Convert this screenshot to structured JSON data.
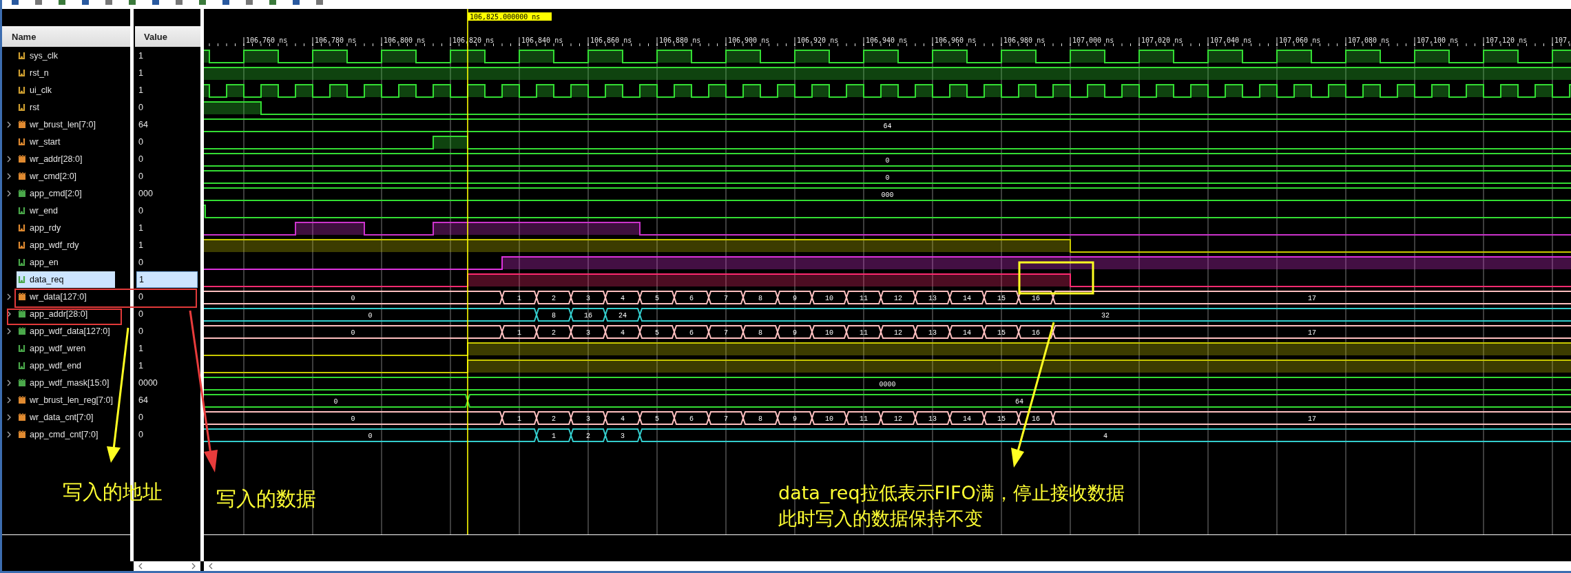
{
  "header": {
    "name": "Name",
    "value": "Value"
  },
  "ruler": {
    "cursor_label": "106,825.000000 ns",
    "ticks": [
      "106,760 ns",
      "106,780 ns",
      "106,800 ns",
      "106,820 ns",
      "106,840 ns",
      "106,860 ns",
      "106,880 ns",
      "106,900 ns",
      "106,920 ns",
      "106,940 ns",
      "106,960 ns",
      "106,980 ns",
      "107,000 ns",
      "107,020 ns",
      "107,040 ns",
      "107,060 ns",
      "107,080 ns",
      "107,100 ns",
      "107,120 ns",
      "107,"
    ]
  },
  "rows": [
    {
      "name": "sys_clk",
      "value": "1",
      "kind": "bit",
      "color": "#33dd33",
      "icon": {
        "color": "#d0a030"
      },
      "selected": false
    },
    {
      "name": "rst_n",
      "value": "1",
      "kind": "bit",
      "color": "#33dd33",
      "icon": {
        "color": "#d0a030"
      },
      "selected": false
    },
    {
      "name": "ui_clk",
      "value": "1",
      "kind": "bit",
      "color": "#33dd33",
      "icon": {
        "color": "#d0a030"
      },
      "selected": false
    },
    {
      "name": "rst",
      "value": "0",
      "kind": "bit",
      "color": "#33dd33",
      "icon": {
        "color": "#d0a030"
      },
      "selected": false
    },
    {
      "name": "wr_brust_len[7:0]",
      "value": "64",
      "kind": "bus",
      "color": "#33dd33",
      "icon": {
        "color": "#e08a30"
      },
      "selected": false,
      "expanded": false,
      "segments": [
        "64"
      ]
    },
    {
      "name": "wr_start",
      "value": "0",
      "kind": "bit",
      "color": "#33dd33",
      "icon": {
        "color": "#e08a30"
      },
      "selected": false
    },
    {
      "name": "wr_addr[28:0]",
      "value": "0",
      "kind": "bus",
      "color": "#33dd33",
      "icon": {
        "color": "#e08a30"
      },
      "selected": false,
      "expanded": false,
      "segments": [
        "0"
      ]
    },
    {
      "name": "wr_cmd[2:0]",
      "value": "0",
      "kind": "bus",
      "color": "#33dd33",
      "icon": {
        "color": "#e08a30"
      },
      "selected": false,
      "expanded": false,
      "segments": [
        "0"
      ]
    },
    {
      "name": "app_cmd[2:0]",
      "value": "000",
      "kind": "bus",
      "color": "#33dd33",
      "icon": {
        "color": "#4aa84a"
      },
      "selected": false,
      "expanded": false,
      "segments": [
        "000"
      ]
    },
    {
      "name": "wr_end",
      "value": "0",
      "kind": "bit",
      "color": "#33dd33",
      "icon": {
        "color": "#4aa84a"
      },
      "selected": false
    },
    {
      "name": "app_rdy",
      "value": "1",
      "kind": "bit",
      "color": "#cc33cc",
      "icon": {
        "color": "#e08a30"
      },
      "selected": false
    },
    {
      "name": "app_wdf_rdy",
      "value": "1",
      "kind": "bit",
      "color": "#c8c800",
      "icon": {
        "color": "#e08a30"
      },
      "selected": false
    },
    {
      "name": "app_en",
      "value": "0",
      "kind": "bit",
      "color": "#dd33dd",
      "icon": {
        "color": "#4aa84a"
      },
      "selected": false
    },
    {
      "name": "data_req",
      "value": "1",
      "kind": "bit",
      "color": "#ff2a70",
      "icon": {
        "color": "#4aa84a"
      },
      "selected": true
    },
    {
      "name": "wr_data[127:0]",
      "value": "0",
      "kind": "bus",
      "color": "#ffc0c0",
      "icon": {
        "color": "#e08a30"
      },
      "selected": false,
      "expanded": false,
      "segments": [
        "0",
        "1",
        "2",
        "3",
        "4",
        "5",
        "6",
        "7",
        "8",
        "9",
        "10",
        "11",
        "12",
        "13",
        "14",
        "15",
        "16",
        "17"
      ]
    },
    {
      "name": "app_addr[28:0]",
      "value": "0",
      "kind": "bus",
      "color": "#33cccc",
      "icon": {
        "color": "#4aa84a"
      },
      "selected": false,
      "expanded": false,
      "segments": [
        "0",
        "8",
        "16",
        "24",
        "32"
      ]
    },
    {
      "name": "app_wdf_data[127:0]",
      "value": "0",
      "kind": "bus",
      "color": "#ffc0c0",
      "icon": {
        "color": "#4aa84a"
      },
      "selected": false,
      "expanded": false,
      "segments": [
        "0",
        "1",
        "2",
        "3",
        "4",
        "5",
        "6",
        "7",
        "8",
        "9",
        "10",
        "11",
        "12",
        "13",
        "14",
        "15",
        "16",
        "17"
      ]
    },
    {
      "name": "app_wdf_wren",
      "value": "1",
      "kind": "bit",
      "color": "#c8c800",
      "icon": {
        "color": "#4aa84a"
      },
      "selected": false
    },
    {
      "name": "app_wdf_end",
      "value": "1",
      "kind": "bit",
      "color": "#c8c800",
      "icon": {
        "color": "#4aa84a"
      },
      "selected": false
    },
    {
      "name": "app_wdf_mask[15:0]",
      "value": "0000",
      "kind": "bus",
      "color": "#33dd33",
      "icon": {
        "color": "#4aa84a"
      },
      "selected": false,
      "expanded": false,
      "segments": [
        "0000"
      ]
    },
    {
      "name": "wr_brust_len_reg[7:0]",
      "value": "64",
      "kind": "bus",
      "color": "#33dd33",
      "icon": {
        "color": "#e08a30"
      },
      "selected": false,
      "expanded": false,
      "segments": [
        "0",
        "64"
      ]
    },
    {
      "name": "wr_data_cnt[7:0]",
      "value": "0",
      "kind": "bus",
      "color": "#ffc0c0",
      "icon": {
        "color": "#e08a30"
      },
      "selected": false,
      "expanded": false,
      "segments": [
        "0",
        "1",
        "2",
        "3",
        "4",
        "5",
        "6",
        "7",
        "8",
        "9",
        "10",
        "11",
        "12",
        "13",
        "14",
        "15",
        "16",
        "17"
      ]
    },
    {
      "name": "app_cmd_cnt[7:0]",
      "value": "0",
      "kind": "bus",
      "color": "#33cccc",
      "icon": {
        "color": "#e08a30"
      },
      "selected": false,
      "expanded": false,
      "segments": [
        "0",
        "1",
        "2",
        "3",
        "4"
      ]
    }
  ],
  "annotations": [
    {
      "kind": "label",
      "lines": [
        "写入的地址"
      ]
    },
    {
      "kind": "label",
      "lines": [
        "写入的数据"
      ]
    },
    {
      "kind": "note",
      "lines": [
        "data_req拉低表示FIFO满，停止接收数据",
        "此时写入的数据保持不变"
      ]
    }
  ]
}
